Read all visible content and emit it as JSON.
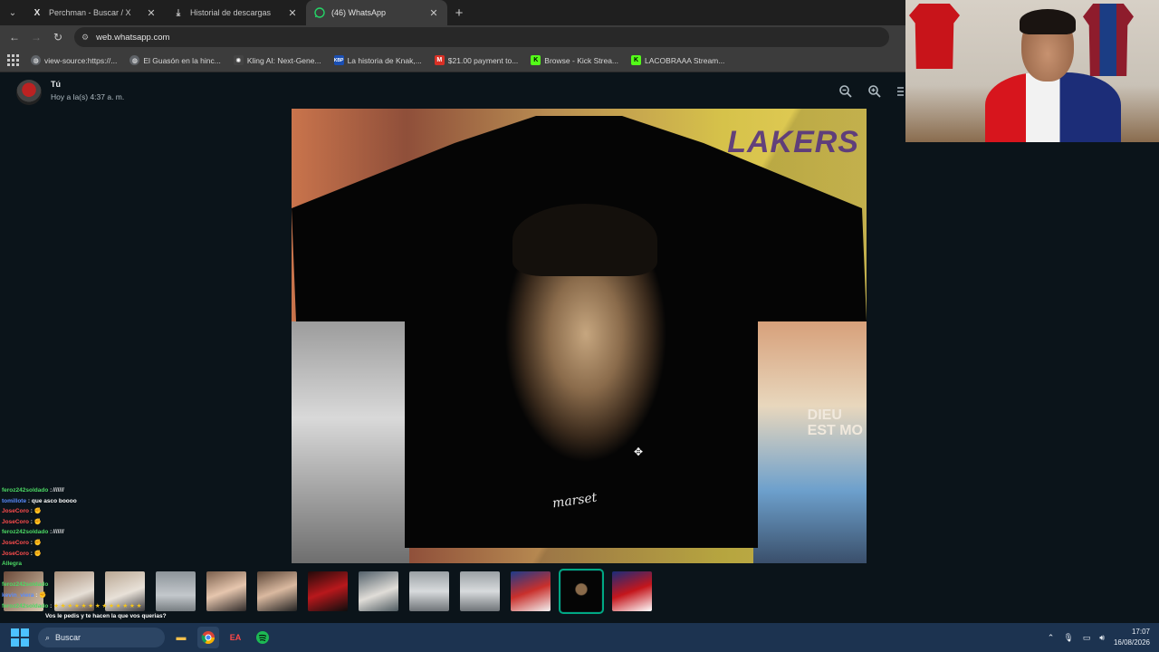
{
  "browser": {
    "tabs": [
      {
        "title": "Perchman - Buscar / X",
        "icon": "x-logo-icon",
        "active": false
      },
      {
        "title": "Historial de descargas",
        "icon": "download-icon",
        "active": false
      },
      {
        "title": "(46) WhatsApp",
        "icon": "whatsapp-icon",
        "active": true
      }
    ],
    "url": "web.whatsapp.com",
    "bookmarks": [
      {
        "label": "view-source:https://...",
        "icon": "globe-icon",
        "color": "#8ab4f8"
      },
      {
        "label": "El Guasón en la hinc...",
        "icon": "globe-icon",
        "color": "#8ab4f8"
      },
      {
        "label": "Kling AI: Next-Gene...",
        "icon": "kling-icon",
        "color": "#cccccc"
      },
      {
        "label": "La historia de Knak,...",
        "icon": "kbp-icon",
        "color": "#1a4fb3"
      },
      {
        "label": "$21.00 payment to...",
        "icon": "gmail-icon",
        "color": "#d93025"
      },
      {
        "label": "Browse - Kick Strea...",
        "icon": "kick-icon",
        "color": "#53fc18"
      },
      {
        "label": "LACOBRAAA Stream...",
        "icon": "kick-icon",
        "color": "#53fc18"
      }
    ]
  },
  "viewer": {
    "sender": "Tú",
    "timestamp": "Hoy a la(s) 4:37 a. m.",
    "signature": "marset",
    "image_texts": {
      "lakers": "LAKERS",
      "dieu": "DIEU\nEST MO"
    },
    "accent": "#00a884"
  },
  "chat": [
    {
      "user": "feroz242soldado",
      "msg": "̸ ̸ ̸ ̸ ̸ ̸ ̸",
      "color": "u"
    },
    {
      "user": "tomillote",
      "msg": "que asco boooo",
      "color": "u3"
    },
    {
      "user": "JoseCoro",
      "msg": "✊",
      "color": "u2"
    },
    {
      "user": "JoseCoro",
      "msg": "✊",
      "color": "u2"
    },
    {
      "user": "feroz242soldado",
      "msg": "̸ ̸ ̸ ̸ ̸ ̸ ̸",
      "color": "u"
    },
    {
      "user": "JoseCoro",
      "msg": "✊",
      "color": "u2"
    },
    {
      "user": "JoseCoro",
      "msg": "✊",
      "color": "u2"
    },
    {
      "user": "Allegra",
      "msg": "",
      "color": "u"
    },
    {
      "user": "",
      "msg": "",
      "color": "u"
    },
    {
      "user": "feroz242soldado",
      "msg": "",
      "color": "u"
    },
    {
      "user": "kevin_viera",
      "msg": "✊",
      "color": "u3"
    },
    {
      "user": "feroz242soldado",
      "msg": "★ ★ ★ ★ ★ ★ ★ ★ ★ ★ ★ ★ ★",
      "color": "u"
    },
    {
      "user": "",
      "msg": "Vos le pedis y te hacen la que vos querias?",
      "color": "m"
    }
  ],
  "taskbar": {
    "search_label": "Buscar",
    "time": "17:07",
    "date": "16/08/2026"
  }
}
